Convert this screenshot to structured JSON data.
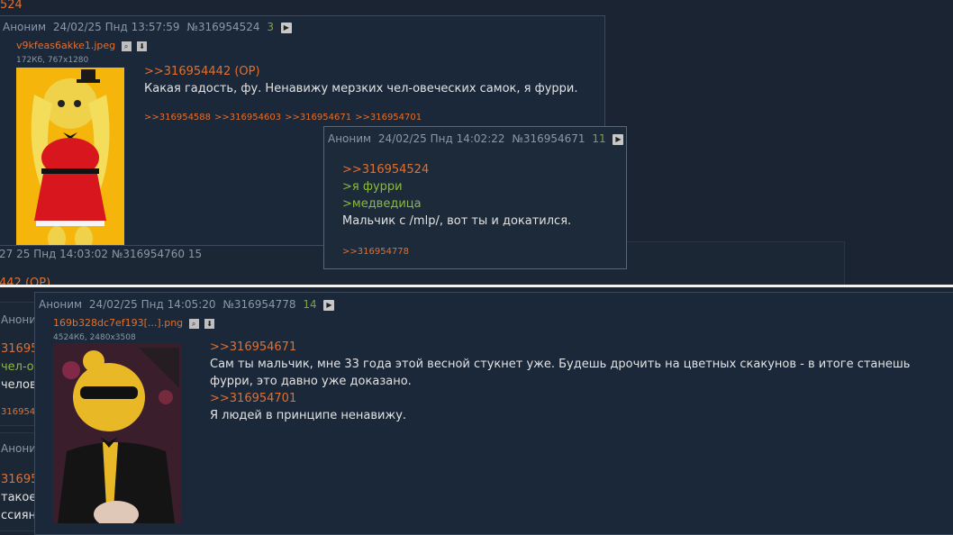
{
  "top_fragment": {
    "text": "524"
  },
  "bg_posts": [
    {
      "header": "27 25 Пнд 14:03:02 №316954760 15",
      "ref": "442 (OP)"
    },
    {
      "header": "Аноним 24/"
    },
    {
      "link1": "31695",
      "green": "чел-ов",
      "text": "челов",
      "link2": "316954"
    },
    {
      "header": "Аноним 24/"
    },
    {
      "link1": "31695",
      "text1": "такое",
      "text2": "ссиян"
    }
  ],
  "post_main": {
    "author": "Аноним",
    "date": "24/02/25 Пнд 13:57:59",
    "number": "№316954524",
    "reply_count": "3",
    "file_name": "v9kfeas6akke1.jpeg",
    "file_info": "172Кб, 767x1280",
    "reply_link": ">>316954442 (OP)",
    "text": "Какая гадость, фу. Ненавижу мерзких чел-овеческих самок, я фурри.",
    "backlinks": [
      ">>316954588",
      ">>316954603",
      ">>316954671",
      ">>316954701"
    ]
  },
  "post_popup": {
    "author": "Аноним",
    "date": "24/02/25 Пнд 14:02:22",
    "number": "№316954671",
    "reply_count": "11",
    "reply_link": ">>316954524",
    "greentext1": ">я фурри",
    "greentext2": ">медведица",
    "text": "Мальчик с /mlp/, вот ты и докатился.",
    "backlinks": [
      ">>316954778"
    ]
  },
  "post_bottom": {
    "author": "Аноним",
    "date": "24/02/25 Пнд 14:05:20",
    "number": "№316954778",
    "reply_count": "14",
    "file_name": "169b328dc7ef193[...].png",
    "file_info": "4524Кб, 2480x3508",
    "reply_link1": ">>316954671",
    "text1": "Сам ты мальчик, мне 33 года этой весной стукнет уже. Будешь дрочить на цветных скакунов - в итоге станешь фурри, это давно уже доказано.",
    "reply_link2": ">>316954701",
    "text2": "Я людей в принципе ненавижу."
  },
  "icons": {
    "expand": "play-icon",
    "search": "search-icon",
    "download": "download-icon"
  }
}
